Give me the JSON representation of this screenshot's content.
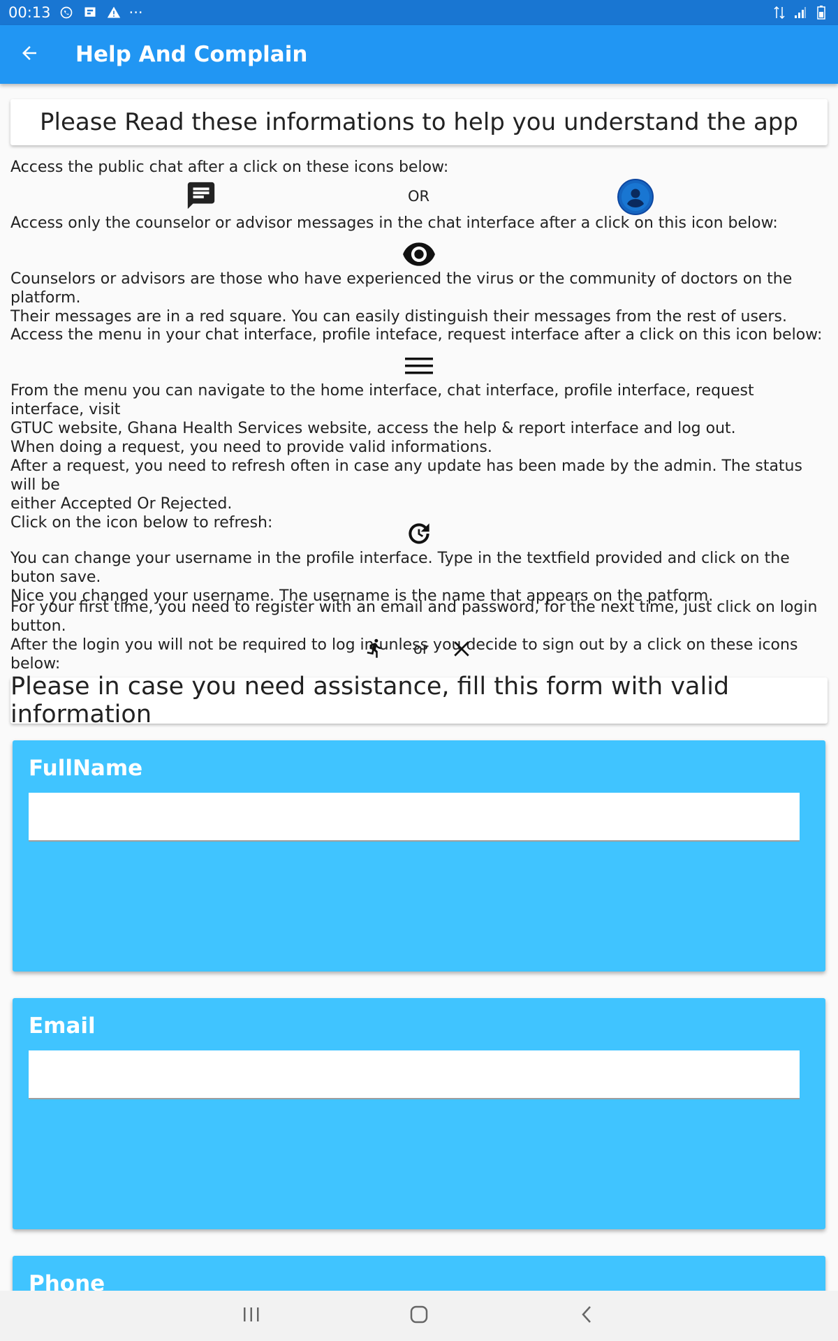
{
  "status_bar": {
    "time": "00:13",
    "more": "···",
    "icons": [
      "whatsapp-icon",
      "notification-icon",
      "warning-icon",
      "data-icon",
      "signal-icon",
      "battery-icon"
    ]
  },
  "app_bar": {
    "back_icon": "arrow-back-icon",
    "title": "Help And Complain"
  },
  "info": {
    "heading": "Please Read these informations to help you understand the app",
    "p1": "Access the public chat after a click on these icons below:",
    "or_upper": "OR",
    "p2": "Access only the counselor or advisor messages  in the chat interface after a click on this icon below:",
    "p3": "Counselors or advisors are those who have experienced the virus or the community of doctors on the platform.\nTheir messages are in a red square. You can easily distinguish their messages from the rest of users.",
    "p4": "Access the menu in your chat interface, profile inteface, request interface after a click on this icon below:",
    "p5": "From the menu you can navigate to the home interface, chat interface, profile interface, request interface, visit\nGTUC website, Ghana Health Services  website, access the help & report interface and log out.",
    "p6": "When doing a request, you need to provide valid informations.\nAfter a request, you need to refresh often in case any update has been made by the admin. The status will be\neither Accepted Or Rejected.\nClick on the icon below to refresh:",
    "p7": "You can change your username in the profile interface. Type in the textfield provided and click on the buton save.\nNice you changed your username. The username is the name that appears on the patform.",
    "p8": "For your first time, you need to register with an email and password, for the next time, just click on login button.\nAfter the login you will not be required to log in unless you decide to sign out by a click on these icons below:",
    "or_lower": "or"
  },
  "form": {
    "heading": "Please in case you need assistance, fill this form with valid information",
    "fullname_label": "FullName",
    "fullname_value": "",
    "email_label": "Email",
    "email_value": "",
    "phone_label": "Phone"
  },
  "colors": {
    "app_bar": "#2196f3",
    "status_bar": "#1976d2",
    "form_card": "#40c4ff",
    "profile_icon": "#1565c0"
  },
  "nav_bar": {
    "icons": [
      "recent-apps-icon",
      "home-icon",
      "back-icon"
    ]
  }
}
